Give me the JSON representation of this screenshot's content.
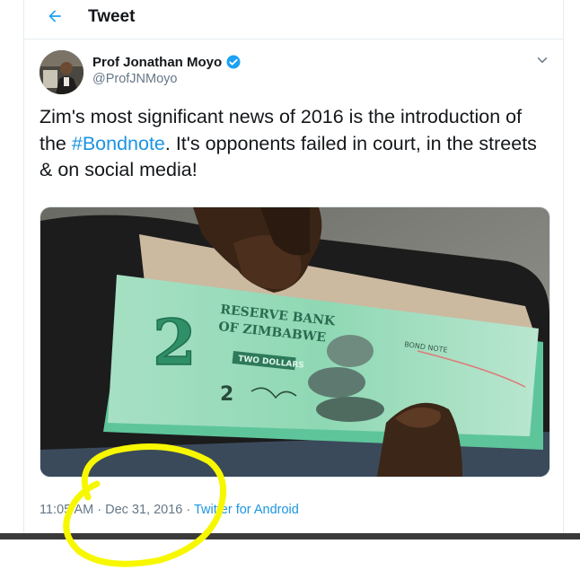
{
  "header": {
    "title": "Tweet",
    "back_icon": "arrow-left-icon",
    "accent_color": "#1da1f2"
  },
  "tweet": {
    "author_name": "Prof Jonathan Moyo",
    "author_handle": "@ProfJNMoyo",
    "verified_icon": "verified-badge-icon",
    "menu_icon": "chevron-down-icon",
    "text_before": "Zim's most significant news of 2016 is the introduction of the ",
    "hashtag": "#Bondnote",
    "text_after": ". It's opponents failed in court, in the streets & on social media!",
    "media": {
      "note_title": "RESERVE BANK OF ZIMBABWE",
      "note_denomination": "2",
      "note_words": "TWO DOLLARS",
      "note_stamp": "BOND NOTE"
    },
    "time": "11:05 AM",
    "separator": " · ",
    "date": "Dec 31, 2016",
    "source": "Twitter for Android"
  },
  "annotation": {
    "highlight_color": "#f7f700"
  }
}
